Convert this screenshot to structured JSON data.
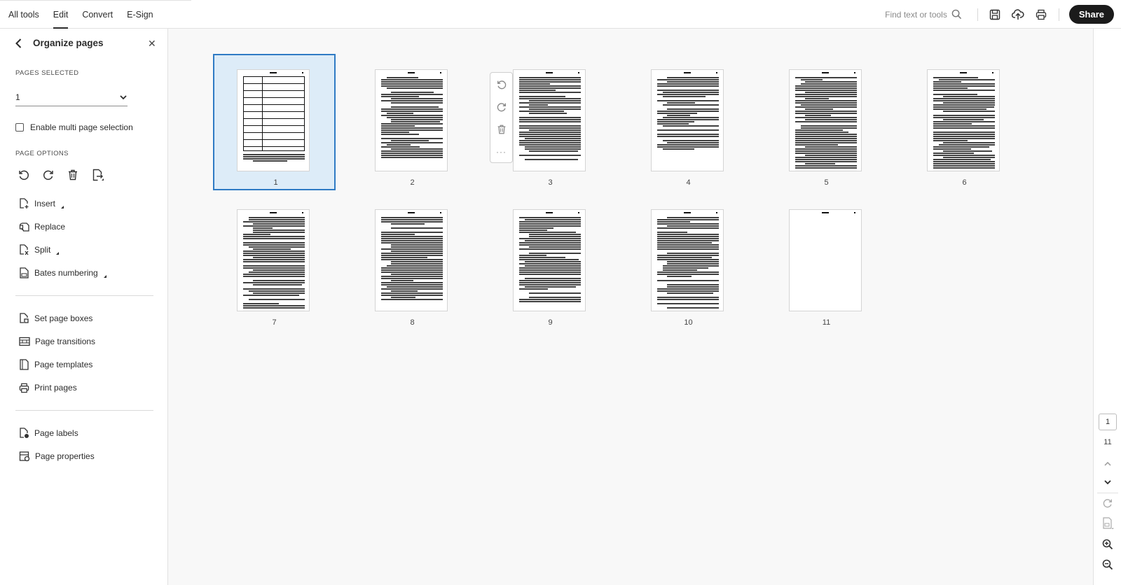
{
  "topbar": {
    "nav": [
      {
        "label": "All tools",
        "active": false
      },
      {
        "label": "Edit",
        "active": true
      },
      {
        "label": "Convert",
        "active": false
      },
      {
        "label": "E-Sign",
        "active": false
      }
    ],
    "search_placeholder": "Find text or tools",
    "icons": [
      "search-icon",
      "save-icon",
      "upload-cloud-icon",
      "print-icon"
    ],
    "share_label": "Share"
  },
  "panel": {
    "title": "Organize pages",
    "pages_selected_label": "PAGES SELECTED",
    "pages_selected_value": "1",
    "multi_select_label": "Enable multi page selection",
    "multi_select_checked": false,
    "page_options_label": "PAGE OPTIONS",
    "option_icons": [
      "rotate-left-icon",
      "rotate-right-icon",
      "delete-icon",
      "extract-icon"
    ],
    "menu_group_1": [
      {
        "label": "Insert",
        "icon": "insert-page-icon",
        "has_submenu": true
      },
      {
        "label": "Replace",
        "icon": "replace-page-icon",
        "has_submenu": false
      },
      {
        "label": "Split",
        "icon": "split-page-icon",
        "has_submenu": true
      },
      {
        "label": "Bates numbering",
        "icon": "bates-icon",
        "has_submenu": true
      }
    ],
    "menu_group_2": [
      {
        "label": "Set page boxes",
        "icon": "page-boxes-icon"
      },
      {
        "label": "Page transitions",
        "icon": "transitions-icon"
      },
      {
        "label": "Page templates",
        "icon": "templates-icon"
      },
      {
        "label": "Print pages",
        "icon": "print-icon"
      }
    ],
    "menu_group_3": [
      {
        "label": "Page labels",
        "icon": "page-labels-icon"
      },
      {
        "label": "Page properties",
        "icon": "page-properties-icon"
      }
    ]
  },
  "main": {
    "pages": [
      "1",
      "2",
      "3",
      "4",
      "5",
      "6",
      "7",
      "8",
      "9",
      "10",
      "11"
    ],
    "selected_page": "1",
    "floating_toolbar": [
      "rotate-left-icon",
      "rotate-right-icon",
      "delete-icon",
      "more-icon"
    ]
  },
  "rail": {
    "current_page": "1",
    "total_pages": "11"
  }
}
